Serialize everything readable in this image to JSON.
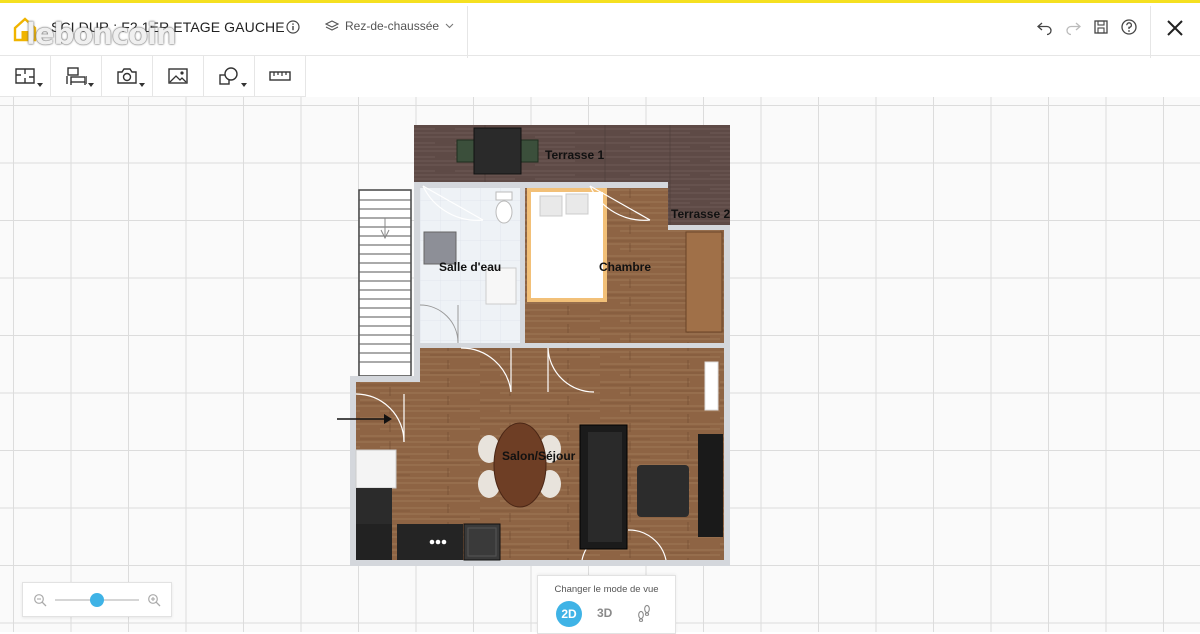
{
  "brand": {
    "watermark": "leboncoin",
    "logo_icon": "house-icon"
  },
  "header": {
    "project_title": "SCI DUR : F2 1ER ETAGE GAUCHE",
    "level": {
      "selected": "Rez-de-chaussée"
    },
    "actions": [
      "undo-icon",
      "redo-icon",
      "save-icon",
      "help-icon",
      "close-icon"
    ]
  },
  "toolbar": {
    "tools": [
      {
        "name": "rooms-tool",
        "icon": "floorplan-icon"
      },
      {
        "name": "furniture-tool",
        "icon": "furniture-icon"
      },
      {
        "name": "camera-tool",
        "icon": "camera-icon"
      },
      {
        "name": "image-tool",
        "icon": "image-icon"
      },
      {
        "name": "shapes-tool",
        "icon": "shapes-icon"
      },
      {
        "name": "measure-tool",
        "icon": "ruler-icon"
      }
    ]
  },
  "floorplan": {
    "rooms": [
      {
        "id": "terrasse1",
        "label": "Terrasse 1"
      },
      {
        "id": "terrasse2",
        "label": "Terrasse 2"
      },
      {
        "id": "salle",
        "label": "Salle d'eau"
      },
      {
        "id": "chambre",
        "label": "Chambre"
      },
      {
        "id": "salon",
        "label": "Salon/Séjour"
      }
    ]
  },
  "zoom": {
    "level_fraction": 0.5
  },
  "view_mode": {
    "label": "Changer le mode de vue",
    "options": [
      "2D",
      "3D"
    ],
    "active": "2D"
  },
  "colors": {
    "accent": "#f5e020",
    "active": "#3fb3e6",
    "terrace": "#5e4a46",
    "floor": "#8e6444",
    "wall": "#d4d7dc"
  }
}
